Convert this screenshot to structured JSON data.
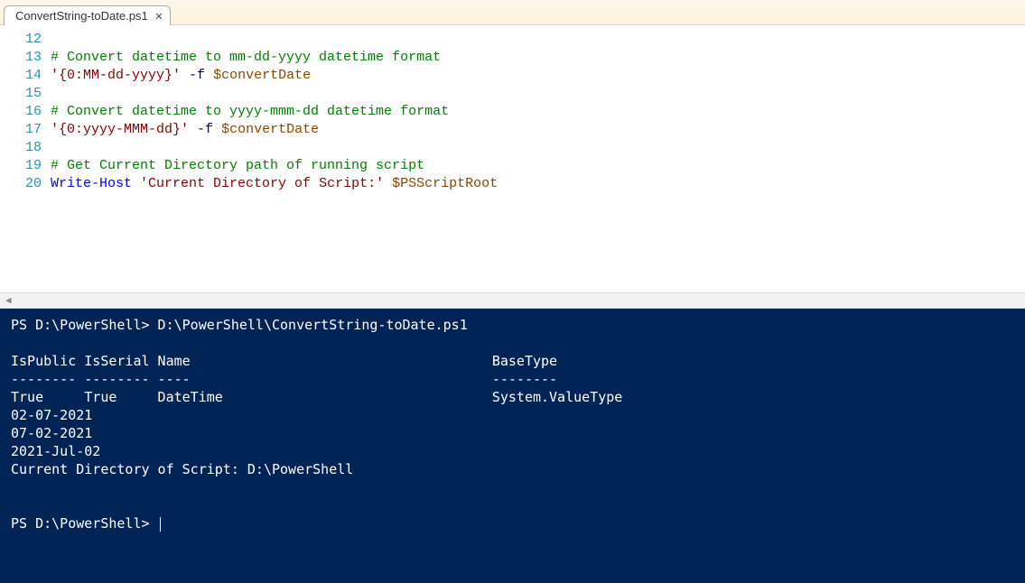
{
  "tab": {
    "title": "ConvertString-toDate.ps1",
    "close": "✕"
  },
  "editor": {
    "startLine": 12,
    "lines": [
      {
        "n": 12,
        "segs": []
      },
      {
        "n": 13,
        "segs": [
          {
            "cls": "tok-comment",
            "t": "# Convert datetime to mm-dd-yyyy datetime format"
          }
        ]
      },
      {
        "n": 14,
        "segs": [
          {
            "cls": "tok-string",
            "t": "'{0:MM-dd-yyyy}'"
          },
          {
            "cls": "",
            "t": " "
          },
          {
            "cls": "tok-param",
            "t": "-f"
          },
          {
            "cls": "",
            "t": " "
          },
          {
            "cls": "tok-var",
            "t": "$convertDate"
          }
        ]
      },
      {
        "n": 15,
        "segs": []
      },
      {
        "n": 16,
        "segs": [
          {
            "cls": "tok-comment",
            "t": "# Convert datetime to yyyy-mmm-dd datetime format"
          }
        ]
      },
      {
        "n": 17,
        "segs": [
          {
            "cls": "tok-string",
            "t": "'{0:yyyy-MMM-dd}'"
          },
          {
            "cls": "",
            "t": " "
          },
          {
            "cls": "tok-param",
            "t": "-f"
          },
          {
            "cls": "",
            "t": " "
          },
          {
            "cls": "tok-var",
            "t": "$convertDate"
          }
        ]
      },
      {
        "n": 18,
        "segs": []
      },
      {
        "n": 19,
        "segs": [
          {
            "cls": "tok-comment",
            "t": "# Get Current Directory path of running script"
          }
        ]
      },
      {
        "n": 20,
        "segs": [
          {
            "cls": "tok-cmdlet",
            "t": "Write-Host"
          },
          {
            "cls": "",
            "t": " "
          },
          {
            "cls": "tok-string",
            "t": "'Current Directory of Script:'"
          },
          {
            "cls": "",
            "t": " "
          },
          {
            "cls": "tok-var",
            "t": "$PSScriptRoot"
          }
        ]
      }
    ]
  },
  "console": {
    "lines": [
      "PS D:\\PowerShell> D:\\PowerShell\\ConvertString-toDate.ps1",
      "",
      "IsPublic IsSerial Name                                     BaseType",
      "-------- -------- ----                                     --------",
      "True     True     DateTime                                 System.ValueType",
      "02-07-2021",
      "07-02-2021",
      "2021-Jul-02",
      "Current Directory of Script: D:\\PowerShell",
      "",
      "",
      "PS D:\\PowerShell> "
    ]
  }
}
